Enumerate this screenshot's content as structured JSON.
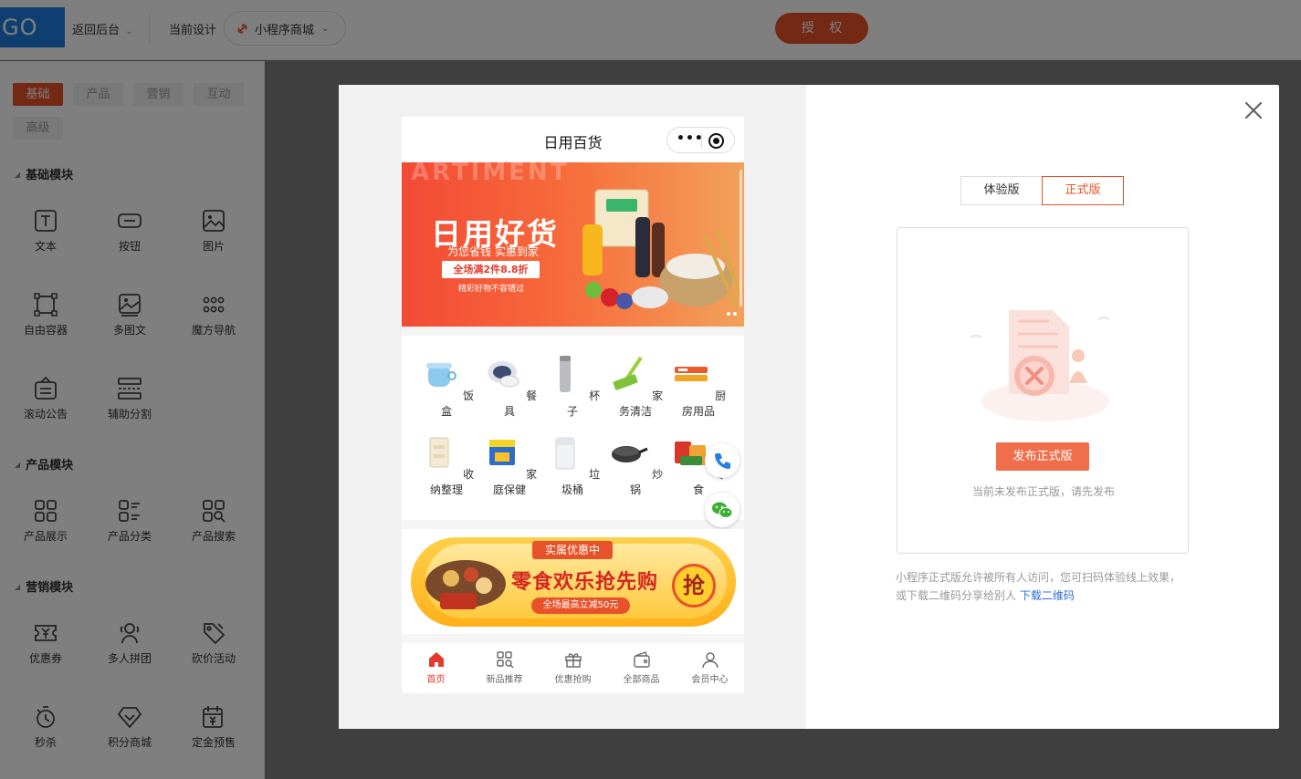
{
  "topbar": {
    "logo": "GO",
    "back_label": "返回后台",
    "current_design_label": "当前设计",
    "app_name": "小程序商城",
    "auth_label": "授 权"
  },
  "sidebar": {
    "tabs": [
      "基础",
      "产品",
      "营销",
      "互动",
      "高级"
    ],
    "sections": [
      {
        "title": "基础模块",
        "items": [
          {
            "label": "文本",
            "icon": "text-icon"
          },
          {
            "label": "按钮",
            "icon": "button-icon"
          },
          {
            "label": "图片",
            "icon": "image-icon"
          },
          {
            "label": "自由容器",
            "icon": "container-icon"
          },
          {
            "label": "多图文",
            "icon": "multi-image-icon"
          },
          {
            "label": "魔方导航",
            "icon": "grid-dots-icon"
          },
          {
            "label": "滚动公告",
            "icon": "notice-icon"
          },
          {
            "label": "辅助分割",
            "icon": "divider-icon"
          }
        ]
      },
      {
        "title": "产品模块",
        "items": [
          {
            "label": "产品展示",
            "icon": "grid-icon"
          },
          {
            "label": "产品分类",
            "icon": "category-icon"
          },
          {
            "label": "产品搜索",
            "icon": "search-grid-icon"
          }
        ]
      },
      {
        "title": "营销模块",
        "items": [
          {
            "label": "优惠券",
            "icon": "coupon-icon"
          },
          {
            "label": "多人拼团",
            "icon": "group-icon"
          },
          {
            "label": "砍价活动",
            "icon": "bargain-icon"
          },
          {
            "label": "秒杀",
            "icon": "stopwatch-icon"
          },
          {
            "label": "积分商城",
            "icon": "diamond-icon"
          },
          {
            "label": "定金预售",
            "icon": "calendar-yen-icon"
          }
        ]
      }
    ]
  },
  "phone": {
    "title": "日用百货",
    "banner": {
      "bg_text": "ARTIMENT",
      "headline": "日用好货",
      "subline": "为您省钱 实惠到家",
      "promo": "全场满2件8.8折",
      "note": "精彩好物不容错过"
    },
    "categories": [
      {
        "label": "饭盒"
      },
      {
        "label": "餐具"
      },
      {
        "label": "杯子"
      },
      {
        "label": "家务清洁"
      },
      {
        "label": "厨房用品"
      },
      {
        "label": "收纳整理"
      },
      {
        "label": "家庭保健"
      },
      {
        "label": "垃圾桶"
      },
      {
        "label": "炒锅"
      },
      {
        "label": "零食"
      }
    ],
    "promo_banner": {
      "tag": "实属优惠中",
      "title": "零食欢乐抢先购",
      "pill": "全场最高立减50元",
      "badge": "抢"
    },
    "tabbar": [
      {
        "label": "首页",
        "active": true
      },
      {
        "label": "新品推荐"
      },
      {
        "label": "优惠抢购"
      },
      {
        "label": "全部商品"
      },
      {
        "label": "会员中心"
      }
    ]
  },
  "publish": {
    "seg_trial": "体验版",
    "seg_release": "正式版",
    "publish_button": "发布正式版",
    "tip": "当前未发布正式版，请先发布",
    "desc": "小程序正式版允许被所有人访问，您可扫码体验线上效果，或下载二维码分享给别人",
    "download_link": "下载二维码"
  },
  "colors": {
    "accent": "#e8522a",
    "link": "#2a6fd6",
    "logo_bg": "#1e7fe0"
  }
}
